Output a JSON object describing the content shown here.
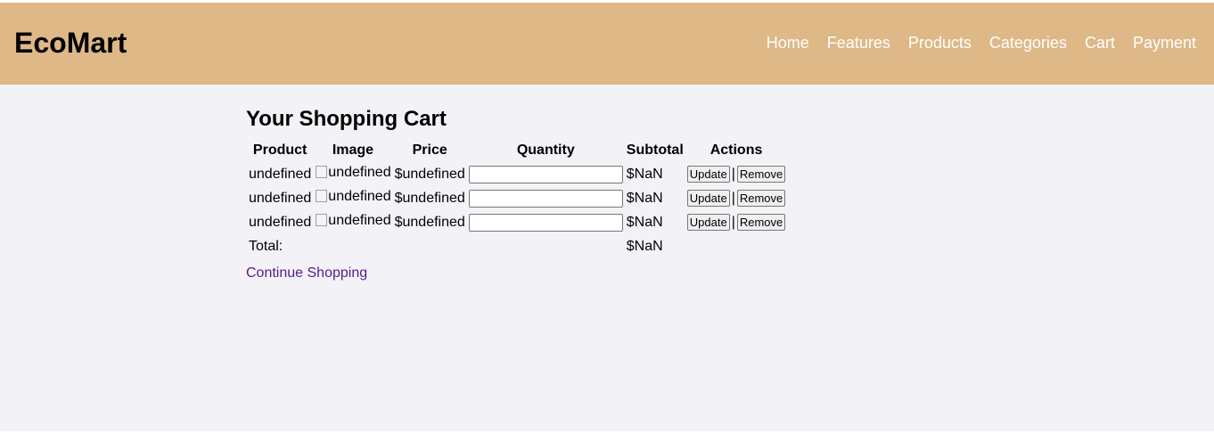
{
  "header": {
    "logo": "EcoMart",
    "nav": [
      "Home",
      "Features",
      "Products",
      "Categories",
      "Cart",
      "Payment"
    ]
  },
  "cart": {
    "title": "Your Shopping Cart",
    "columns": [
      "Product",
      "Image",
      "Price",
      "Quantity",
      "Subtotal",
      "Actions"
    ],
    "rows": [
      {
        "product": "undefined",
        "image_alt": "undefined",
        "price": "$undefined",
        "quantity": "",
        "subtotal": "$NaN",
        "update_label": "Update",
        "separator": "|",
        "remove_label": "Remove"
      },
      {
        "product": "undefined",
        "image_alt": "undefined",
        "price": "$undefined",
        "quantity": "",
        "subtotal": "$NaN",
        "update_label": "Update",
        "separator": "|",
        "remove_label": "Remove"
      },
      {
        "product": "undefined",
        "image_alt": "undefined",
        "price": "$undefined",
        "quantity": "",
        "subtotal": "$NaN",
        "update_label": "Update",
        "separator": "|",
        "remove_label": "Remove"
      }
    ],
    "total_label": "Total:",
    "total_value": "$NaN",
    "continue_label": "Continue Shopping"
  },
  "colors": {
    "header_bg": "#deb887",
    "page_bg": "#f3f3f7",
    "nav_text": "#ffffff",
    "link_visited": "#551a8b"
  }
}
